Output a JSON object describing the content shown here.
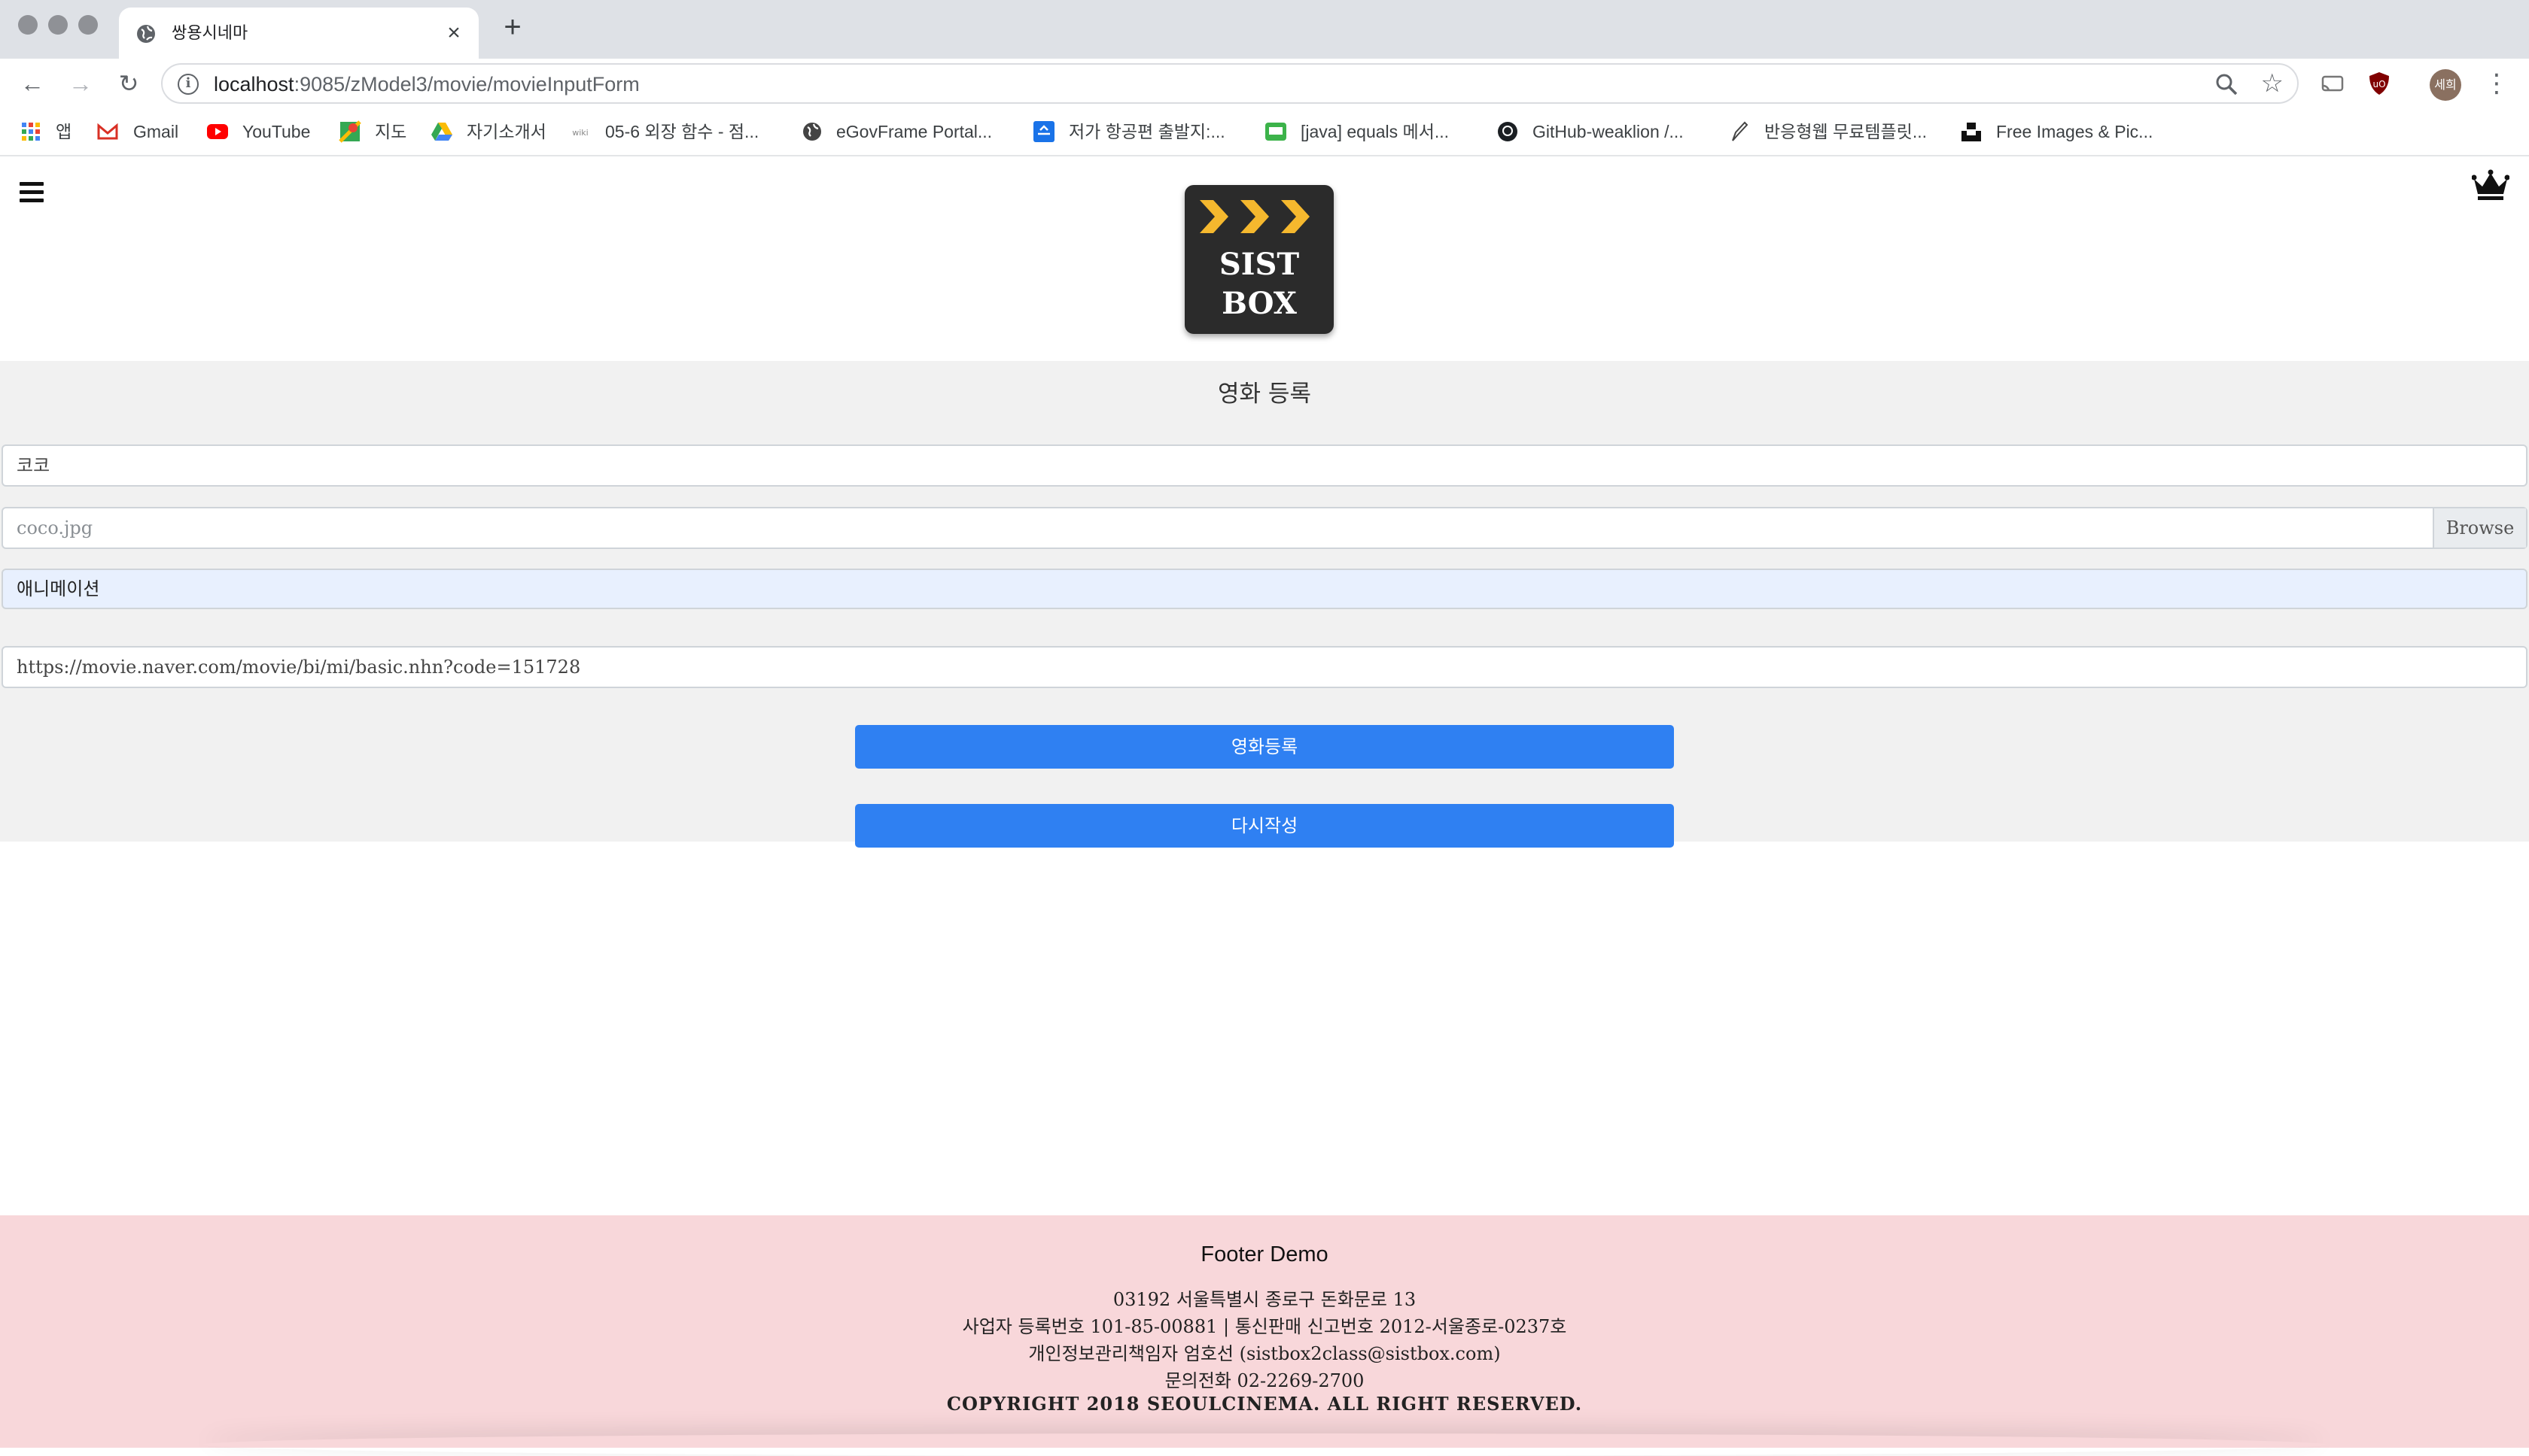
{
  "browser": {
    "tab_title": "쌍용시네마",
    "url_host": "localhost",
    "url_path": ":9085/zModel3/movie/movieInputForm",
    "profile_label": "세희",
    "bookmarks": [
      "앱",
      "Gmail",
      "YouTube",
      "지도",
      "자기소개서",
      "05-6 외장 함수 - 점...",
      "eGovFrame Portal...",
      "저가 항공편 출발지:...",
      "[java] equals 메서...",
      "GitHub-weaklion /...",
      "반응형웹 무료템플릿...",
      "Free Images & Pic..."
    ]
  },
  "header": {
    "logo_line1": "SIST",
    "logo_line2": "BOX"
  },
  "form": {
    "title": "영화 등록",
    "movie_title_value": "코코",
    "poster_file_placeholder": "coco.jpg",
    "browse_label": "Browse",
    "genre_value": "애니메이션",
    "link_value": "https://movie.naver.com/movie/bi/mi/basic.nhn?code=151728",
    "submit_label": "영화등록",
    "reset_label": "다시작성"
  },
  "footer": {
    "title": "Footer Demo",
    "address": "03192 서울특별시 종로구 돈화문로 13",
    "business": "사업자 등록번호 101-85-00881 | 통신판매 신고번호 2012-서울종로-0237호",
    "privacy": "개인정보관리책임자 엄호선 (sistbox2class@sistbox.com)",
    "phone": "문의전화 02-2269-2700",
    "copyright": "COPYRIGHT 2018 SEOULCINEMA. ALL RIGHT RESERVED."
  },
  "colors": {
    "primary_button": "#2f80f2",
    "form_background": "#f1f1f1",
    "footer_background": "#f8d7da",
    "logo_chevron": "#f5b82e"
  }
}
